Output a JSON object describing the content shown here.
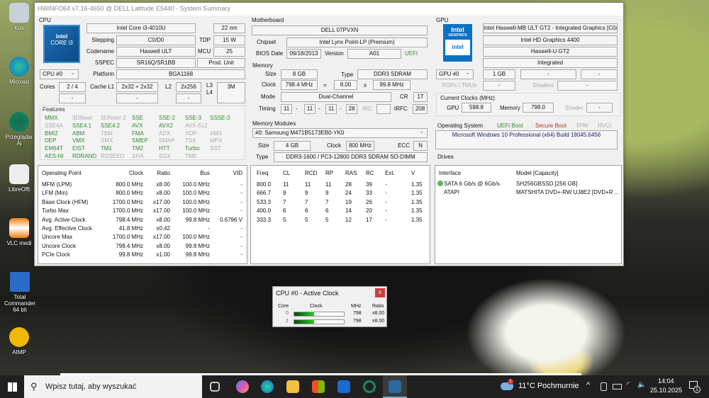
{
  "desktop": {
    "icons": [
      {
        "label": "Kos"
      },
      {
        "label": "Microso"
      },
      {
        "label": "Przeglądar",
        "label2": "Ai"
      },
      {
        "label": "LibreOffi"
      },
      {
        "label": "VLC medi"
      },
      {
        "label": "Total Commander",
        "label2": "64 bit"
      },
      {
        "label": "AIMP"
      }
    ]
  },
  "window": {
    "title": "HWiNFO64 v7.16-4650 @ DELL Latitude E5440 - System Summary"
  },
  "cpu": {
    "section": "CPU",
    "logo": "intel CORE i3 inside",
    "name": "Intel Core i3-4010U",
    "process": "22 nm",
    "stepping_label": "Stepping",
    "stepping": "C0/D0",
    "tdp_label": "TDP",
    "tdp": "15 W",
    "codename_label": "Codename",
    "codename": "Haswell ULT",
    "mcu_label": "MCU",
    "mcu": "25",
    "sspec_label": "SSPEC",
    "sspec": "SR16Q/SR1BB",
    "prod": "Prod. Unit",
    "selector": "CPU #0",
    "platform_label": "Platform",
    "platform": "BGA1168",
    "cores_label": "Cores",
    "cores": "2 / 4",
    "cores2": "-",
    "l1_label": "Cache L1",
    "l1": "2x32 + 2x32",
    "l1b": "-",
    "l2_label": "L2",
    "l2": "2x256",
    "l2b": "-",
    "l3_label": "L3",
    "l4_label": "L4",
    "l3": "3M"
  },
  "features": {
    "label": "Features",
    "items": [
      {
        "n": "MMX",
        "on": true
      },
      {
        "n": "3DNow!",
        "on": false
      },
      {
        "n": "3DNow!-2",
        "on": false
      },
      {
        "n": "SSE",
        "on": true
      },
      {
        "n": "SSE-2",
        "on": true
      },
      {
        "n": "SSE-3",
        "on": true
      },
      {
        "n": "SSSE-3",
        "on": true
      },
      {
        "n": "SSE4A",
        "on": false
      },
      {
        "n": "SSE4.1",
        "on": true
      },
      {
        "n": "SSE4.2",
        "on": true
      },
      {
        "n": "AVX",
        "on": true
      },
      {
        "n": "AVX2",
        "on": true
      },
      {
        "n": "AVX-512",
        "on": false
      },
      {
        "n": "",
        "on": false
      },
      {
        "n": "BMI2",
        "on": true
      },
      {
        "n": "ABM",
        "on": true
      },
      {
        "n": "TBM",
        "on": false
      },
      {
        "n": "FMA",
        "on": true
      },
      {
        "n": "ADX",
        "on": false
      },
      {
        "n": "XOP",
        "on": false
      },
      {
        "n": "AMX",
        "on": false
      },
      {
        "n": "DEP",
        "on": true
      },
      {
        "n": "VMX",
        "on": true
      },
      {
        "n": "SMX",
        "on": false
      },
      {
        "n": "SMEP",
        "on": true
      },
      {
        "n": "SMAP",
        "on": false
      },
      {
        "n": "TSX",
        "on": false
      },
      {
        "n": "MPX",
        "on": false
      },
      {
        "n": "EM64T",
        "on": true
      },
      {
        "n": "EIST",
        "on": true
      },
      {
        "n": "TM1",
        "on": true
      },
      {
        "n": "TM2",
        "on": true
      },
      {
        "n": "HTT",
        "on": true
      },
      {
        "n": "Turbo",
        "on": true
      },
      {
        "n": "SST",
        "on": false
      },
      {
        "n": "AES-NI",
        "on": true
      },
      {
        "n": "RDRAND",
        "on": true
      },
      {
        "n": "RDSEED",
        "on": false
      },
      {
        "n": "SHA",
        "on": false
      },
      {
        "n": "SGX",
        "on": false
      },
      {
        "n": "TME",
        "on": false
      },
      {
        "n": "",
        "on": false
      }
    ]
  },
  "op": {
    "headers": [
      "Operating Point",
      "Clock",
      "Ratio",
      "Bus",
      "VID"
    ],
    "rows": [
      [
        "MFM (LPM)",
        "800.0 MHz",
        "x8.00",
        "100.0 MHz",
        "-"
      ],
      [
        "LFM (Min)",
        "800.0 MHz",
        "x8.00",
        "100.0 MHz",
        "-"
      ],
      [
        "Base Clock (HFM)",
        "1700.0 MHz",
        "x17.00",
        "100.0 MHz",
        "-"
      ],
      [
        "Turbo Max",
        "1700.0 MHz",
        "x17.00",
        "100.0 MHz",
        "-"
      ],
      [
        "Avg. Active Clock",
        "798.4 MHz",
        "x8.00",
        "99.8 MHz",
        "0.6796 V"
      ],
      [
        "Avg. Effective Clock",
        "41.8 MHz",
        "x0.42",
        "-",
        "-"
      ],
      [
        "Uncore Max",
        "1700.0 MHz",
        "x17.00",
        "100.0 MHz",
        "-"
      ],
      [
        "Uncore Clock",
        "798.4 MHz",
        "x8.00",
        "99.8 MHz",
        "-"
      ],
      [
        "PCIe Clock",
        "99.8 MHz",
        "x1.00",
        "99.8 MHz",
        "-"
      ]
    ]
  },
  "mb": {
    "section": "Motherboard",
    "name": "DELL 07PVXN",
    "chipset_label": "Chipset",
    "chipset": "Intel Lynx Point-LP (Premium)",
    "bios_label": "BIOS Date",
    "bios": "09/18/2013",
    "version_label": "Version",
    "version": "A01",
    "uefi": "UEFI"
  },
  "mem": {
    "section": "Memory",
    "size_label": "Size",
    "size": "8 GB",
    "type_label": "Type",
    "type": "DDR3 SDRAM",
    "clock_label": "Clock",
    "clock": "798.4 MHz",
    "eq": "=",
    "mult": "8.00",
    "x": "x",
    "bus": "99.8 MHz",
    "mode_label": "Mode",
    "mode": "Dual-Channel",
    "cr_label": "CR",
    "cr": "1T",
    "timing_label": "Timing",
    "t1": "11",
    "t2": "11",
    "t3": "11",
    "t4": "28",
    "dash": "-",
    "trc_label": "tRC",
    "trfc_label": "tRFC",
    "trfc": "208"
  },
  "modules": {
    "section": "Memory Modules",
    "selected": "#0: Samsung M471B5173EB0-YK0",
    "size_label": "Size",
    "size": "4 GB",
    "clock_label": "Clock",
    "clock": "800 MHz",
    "ecc_label": "ECC",
    "ecc": "N",
    "type_label": "Type",
    "type": "DDR3-1600 / PC3-12800 DDR3 SDRAM SO-DIMM"
  },
  "spd": {
    "headers": [
      "Freq",
      "CL",
      "RCD",
      "RP",
      "RAS",
      "RC",
      "Ext.",
      "V"
    ],
    "rows": [
      [
        "800.0",
        "11",
        "11",
        "11",
        "28",
        "39",
        "-",
        "1.35"
      ],
      [
        "666.7",
        "9",
        "9",
        "9",
        "24",
        "33",
        "-",
        "1.35"
      ],
      [
        "533.3",
        "7",
        "7",
        "7",
        "19",
        "26",
        "-",
        "1.35"
      ],
      [
        "400.0",
        "6",
        "6",
        "6",
        "14",
        "20",
        "-",
        "1.35"
      ],
      [
        "333.3",
        "5",
        "5",
        "5",
        "12",
        "17",
        "-",
        "1.35"
      ]
    ]
  },
  "gpu": {
    "section": "GPU",
    "logo": "Intel GRAPHICS",
    "full": "Intel Haswell-MB ULT GT2 - Integrated Graphics [C0/I",
    "name": "Intel HD Graphics 4400",
    "code": "Haswell-U GT2",
    "kind": "Integrated",
    "selector": "GPU #0",
    "vram": "1 GB",
    "f1": "-",
    "f2": "-",
    "rops_label": "ROPs / TMUs",
    "rops": "-",
    "shaders_label": "Shaders",
    "shaders": "-",
    "clocks_label": "Current Clocks (MHz)",
    "gpu_label": "GPU",
    "gpu_clock": "598.8",
    "mem_label": "Memory",
    "mem_clock": "798.0",
    "shader_label": "Shader",
    "shader_clock": "-"
  },
  "os": {
    "section": "Operating System",
    "uefi": "UEFI Boot",
    "secure": "Secure Boot",
    "tpm": "TPM",
    "hvci": "HVCI",
    "name": "Microsoft Windows 10 Professional (x64) Build 19045.6456"
  },
  "drives": {
    "section": "Drives",
    "headers": [
      "Interface",
      "Model [Capacity]"
    ],
    "rows": [
      [
        "SATA 6 Gb/s @ 6Gb/s",
        "SH256GBSSD [256 GB]"
      ],
      [
        "ATAPI",
        "MATSHITA DVD+-RW UJ8E2 [DVD+R ..."
      ]
    ]
  },
  "mini": {
    "title": "CPU #0 - Active Clock",
    "close": "x",
    "headers": [
      "Core",
      "Clock",
      "MHz",
      "Ratio"
    ],
    "rows": [
      {
        "core": "0",
        "fill": 0.4,
        "mhz": "798",
        "ratio": "x8.00"
      },
      {
        "core": "1",
        "fill": 0.4,
        "mhz": "798",
        "ratio": "x8.00"
      }
    ]
  },
  "taskbar": {
    "search": "Wpisz tutaj, aby wyszukać",
    "weather": "11°C Pochmurnie",
    "weather_badge": "1",
    "time": "14:04",
    "date": "25.10.2025",
    "notif": "1"
  }
}
